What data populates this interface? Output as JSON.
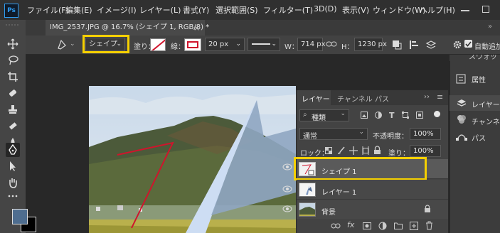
{
  "menu": {
    "logo": "Ps",
    "items": [
      "ファイル(F)",
      "編集(E)",
      "イメージ(I)",
      "レイヤー(L)",
      "書式(Y)",
      "選択範囲(S)",
      "フィルター(T)",
      "3D(D)",
      "表示(V)",
      "ウィンドウ(W)",
      "ヘルプ(H)"
    ]
  },
  "document": {
    "tab_title": "IMG_2537.JPG @ 16.7% (シェイプ 1, RGB/8) *"
  },
  "options": {
    "mode": "シェイプ",
    "fill_label": "塗り：",
    "stroke_label": "線：",
    "stroke_width": "20 px",
    "w_label": "W：",
    "w_value": "714 px",
    "h_label": "H：",
    "h_value": "1230 px",
    "auto_add_label": "自動追加"
  },
  "right_panel": {
    "items": [
      {
        "label": "スウォッチ",
        "icon": "swatches-icon"
      },
      {
        "label": "属性",
        "icon": "properties-icon"
      },
      {
        "label": "レイヤー",
        "icon": "layers-icon"
      },
      {
        "label": "チャンネル",
        "icon": "channels-icon"
      },
      {
        "label": "パス",
        "icon": "paths-icon"
      }
    ]
  },
  "layers_panel": {
    "tabs": [
      "レイヤー",
      "チャンネル",
      "パス"
    ],
    "filter_kind": "種類",
    "blend_mode": "通常",
    "opacity_label": "不透明度：",
    "opacity_value": "100%",
    "lock_label": "ロック：",
    "fill_label": "塗り：",
    "fill_value": "100%",
    "layers": [
      {
        "name": "シェイプ 1",
        "selected": true
      },
      {
        "name": "レイヤー 1",
        "selected": false
      },
      {
        "name": "背景",
        "selected": false
      }
    ]
  },
  "colors": {
    "highlight": "#f5d000",
    "stroke_red": "#d0142c",
    "foreground": "#4e6d8f",
    "background": "#000000"
  }
}
